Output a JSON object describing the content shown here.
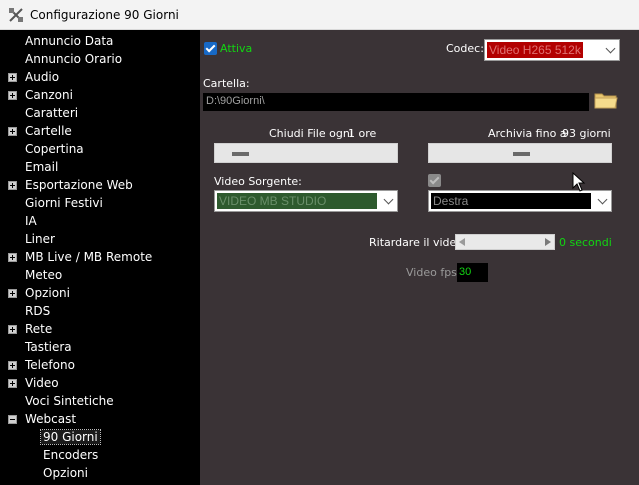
{
  "window": {
    "title": "Configurazione 90 Giorni"
  },
  "sidebar": {
    "items": [
      {
        "label": "Annuncio Data",
        "expander": "none",
        "indent": 0
      },
      {
        "label": "Annuncio Orario",
        "expander": "none",
        "indent": 0
      },
      {
        "label": "Audio",
        "expander": "plus",
        "indent": 0
      },
      {
        "label": "Canzoni",
        "expander": "plus",
        "indent": 0
      },
      {
        "label": "Caratteri",
        "expander": "none",
        "indent": 0
      },
      {
        "label": "Cartelle",
        "expander": "plus",
        "indent": 0
      },
      {
        "label": "Copertina",
        "expander": "none",
        "indent": 0
      },
      {
        "label": "Email",
        "expander": "none",
        "indent": 0
      },
      {
        "label": "Esportazione Web",
        "expander": "plus",
        "indent": 0
      },
      {
        "label": "Giorni Festivi",
        "expander": "none",
        "indent": 0
      },
      {
        "label": "IA",
        "expander": "none",
        "indent": 0
      },
      {
        "label": "Liner",
        "expander": "none",
        "indent": 0
      },
      {
        "label": "MB Live / MB Remote",
        "expander": "plus",
        "indent": 0
      },
      {
        "label": "Meteo",
        "expander": "none",
        "indent": 0
      },
      {
        "label": "Opzioni",
        "expander": "plus",
        "indent": 0
      },
      {
        "label": "RDS",
        "expander": "none",
        "indent": 0
      },
      {
        "label": "Rete",
        "expander": "plus",
        "indent": 0
      },
      {
        "label": "Tastiera",
        "expander": "none",
        "indent": 0
      },
      {
        "label": "Telefono",
        "expander": "plus",
        "indent": 0
      },
      {
        "label": "Video",
        "expander": "plus",
        "indent": 0
      },
      {
        "label": "Voci Sintetiche",
        "expander": "none",
        "indent": 0
      },
      {
        "label": "Webcast",
        "expander": "minus",
        "indent": 0
      },
      {
        "label": "90 Giorni",
        "expander": "none",
        "indent": 1,
        "selected": true
      },
      {
        "label": "Encoders",
        "expander": "none",
        "indent": 1
      },
      {
        "label": "Opzioni",
        "expander": "none",
        "indent": 1
      }
    ]
  },
  "main": {
    "active": {
      "label": "Attiva",
      "checked": true
    },
    "codec": {
      "label": "Codec:",
      "value": "Video H265 512k"
    },
    "folder": {
      "label": "Cartella:",
      "path": "D:\\90Giorni\\"
    },
    "close_file": {
      "label": "Chiudi File ogni",
      "value": "1 ore"
    },
    "archive": {
      "label": "Archivia fino a",
      "value": "93 giorni"
    },
    "video_source": {
      "label": "Video Sorgente:",
      "value": "VIDEO MB STUDIO"
    },
    "position": {
      "checked": false,
      "value": "Destra"
    },
    "delay": {
      "label": "Ritardare il video:",
      "value": "0 secondi"
    },
    "fps": {
      "label": "Video fps:",
      "value": "30"
    }
  },
  "colors": {
    "panel_bg": "#3a3336",
    "sidebar_bg": "#000000",
    "codec_highlight": "#b20000",
    "source_bg": "#2e5a2e",
    "accent_green": "#12d612",
    "checkbox_blue": "#1769c6"
  }
}
